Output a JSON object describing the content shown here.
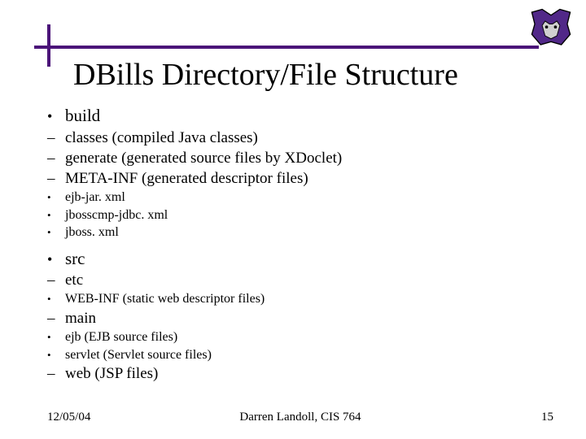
{
  "title": "DBills Directory/File Structure",
  "bullets": {
    "build": "build",
    "build_classes": "classes (compiled Java classes)",
    "build_generate": "generate (generated source files by XDoclet)",
    "build_metainf": "META-INF (generated descriptor files)",
    "ejb_jar": "ejb-jar. xml",
    "jbosscmp": "jbosscmp-jdbc. xml",
    "jboss": "jboss. xml",
    "src": "src",
    "src_etc": "etc",
    "webinf": "WEB-INF (static web descriptor files)",
    "src_main": "main",
    "ejb": "ejb (EJB source files)",
    "servlet": "servlet (Servlet source files)",
    "src_web": "web (JSP files)"
  },
  "footer": {
    "date": "12/05/04",
    "author": "Darren Landoll, CIS 764",
    "page": "15"
  }
}
